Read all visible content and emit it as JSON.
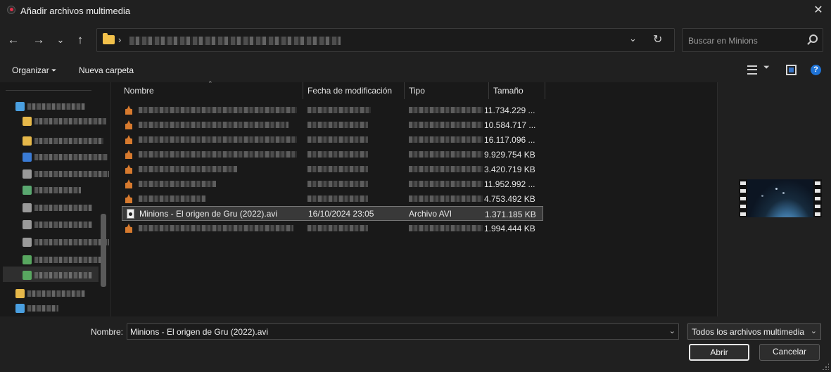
{
  "window": {
    "title": "Añadir archivos multimedia",
    "close_glyph": "✕"
  },
  "nav": {
    "back_glyph": "←",
    "forward_glyph": "→",
    "recent_glyph": "⌄",
    "up_glyph": "↑",
    "breadcrumb_sep": "›",
    "address_dropdown_glyph": "⌄",
    "refresh_glyph": "↻",
    "search_placeholder": "Buscar en Minions"
  },
  "toolbar": {
    "organize_label": "Organizar",
    "organize_dropdown_glyph": "⏷",
    "new_folder_label": "Nueva carpeta",
    "view_dropdown_glyph": "⏷",
    "help_glyph": "?"
  },
  "sidebar": {
    "icon_colors": [
      "#4a9fe0",
      "#e6b84a",
      "#e6b84a",
      "#3a7bd5",
      "#9a9a9a",
      "#5aa870",
      "#9a9a9a",
      "#9a9a9a",
      "#9a9a9a",
      "#58a760",
      "#58a760",
      "#e6b84a",
      "#4a9fe0"
    ]
  },
  "columns": {
    "name": "Nombre",
    "modified": "Fecha de modificación",
    "type": "Tipo",
    "size": "Tamaño"
  },
  "files": [
    {
      "size": "11.734.229 ..."
    },
    {
      "size": "10.584.717 ..."
    },
    {
      "size": "16.117.096 ..."
    },
    {
      "size": "9.929.754 KB"
    },
    {
      "size": "3.420.719 KB"
    },
    {
      "size": "11.952.992 ..."
    },
    {
      "size": "4.753.492 KB"
    },
    {
      "name": "Minions - El origen de Gru (2022).avi",
      "modified": "16/10/2024 23:05",
      "type": "Archivo AVI",
      "size": "1.371.185 KB",
      "selected": true
    },
    {
      "size": "1.994.444 KB"
    }
  ],
  "footer": {
    "name_label": "Nombre:",
    "name_value": "Minions - El origen de Gru (2022).avi",
    "name_dropdown_glyph": "⌄",
    "filter_value": "Todos los archivos multimedia",
    "filter_dropdown_glyph": "⌄",
    "open_label": "Abrir",
    "cancel_label": "Cancelar"
  }
}
